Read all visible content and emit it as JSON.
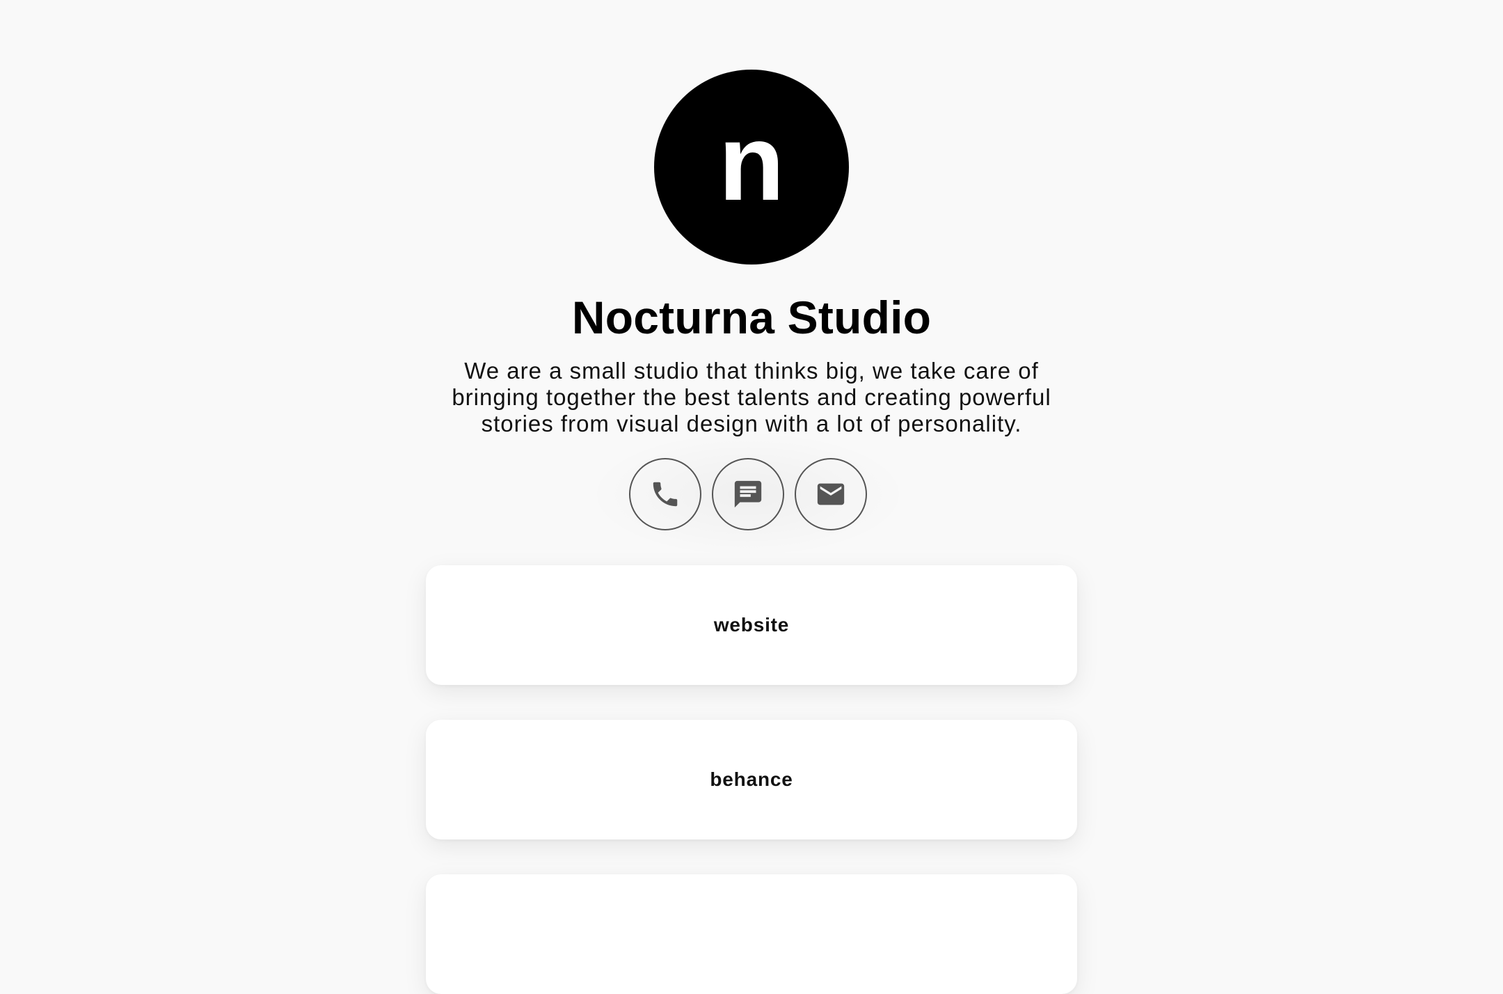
{
  "profile": {
    "avatar_letter": "n",
    "name": "Nocturna Studio",
    "bio": "We are a small studio that thinks big, we take care of bringing together the best talents and creating powerful stories from visual design with a lot of personality."
  },
  "contacts": [
    {
      "icon": "phone-icon"
    },
    {
      "icon": "message-icon"
    },
    {
      "icon": "mail-icon"
    }
  ],
  "links": [
    {
      "label": "website"
    },
    {
      "label": "behance"
    },
    {
      "label": ""
    }
  ],
  "colors": {
    "background": "#f9f9f9",
    "avatar": "#000000",
    "icon": "#555555",
    "card": "#ffffff"
  }
}
